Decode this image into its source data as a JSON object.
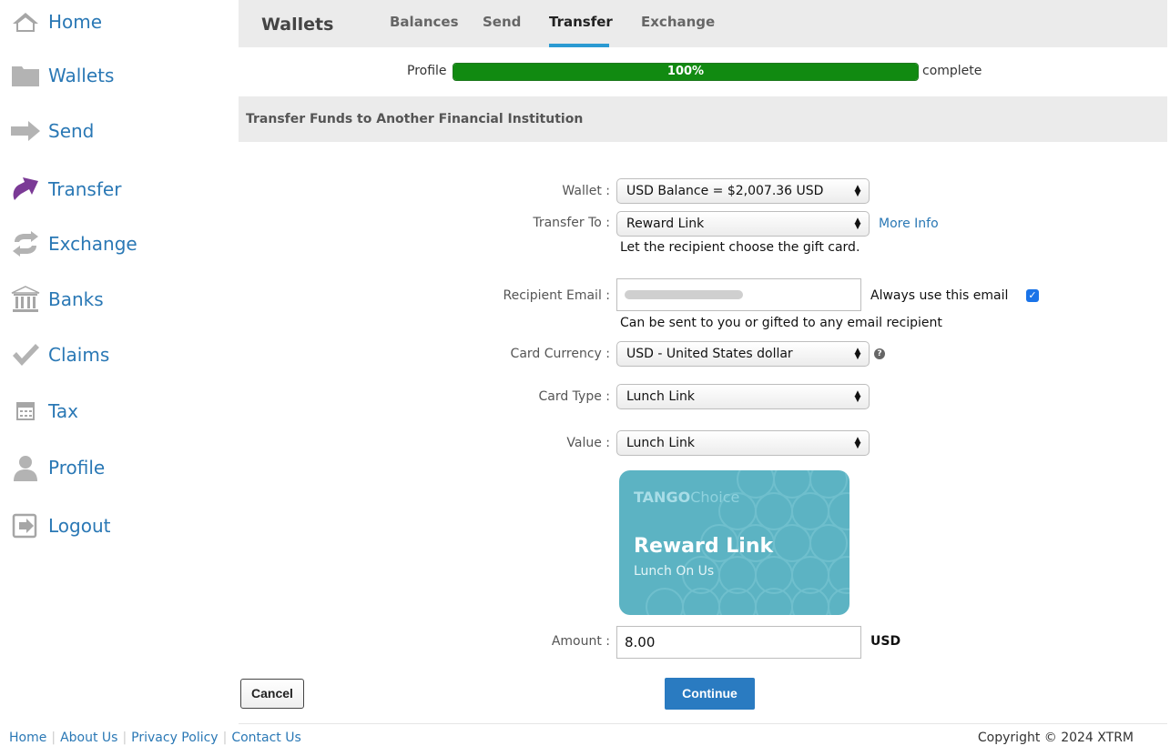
{
  "sidebar": {
    "items": [
      {
        "label": "Home",
        "icon": "home-icon"
      },
      {
        "label": "Wallets",
        "icon": "folder-icon"
      },
      {
        "label": "Send",
        "icon": "arrow-right-icon"
      },
      {
        "label": "Transfer",
        "icon": "transfer-icon"
      },
      {
        "label": "Exchange",
        "icon": "exchange-icon"
      },
      {
        "label": "Banks",
        "icon": "bank-icon"
      },
      {
        "label": "Claims",
        "icon": "checkmark-icon"
      },
      {
        "label": "Tax",
        "icon": "calculator-icon"
      },
      {
        "label": "Profile",
        "icon": "user-icon"
      },
      {
        "label": "Logout",
        "icon": "logout-icon"
      }
    ],
    "active": "Transfer",
    "active_color": "#7b3a96"
  },
  "header": {
    "title": "Wallets",
    "tabs": [
      {
        "label": "Balances"
      },
      {
        "label": "Send"
      },
      {
        "label": "Transfer"
      },
      {
        "label": "Exchange"
      }
    ],
    "active_tab": "Transfer"
  },
  "profile_progress": {
    "prefix": "Profile",
    "value_text": "100%",
    "suffix": "complete",
    "fraction": 1.0,
    "color": "#118a11"
  },
  "section": {
    "title": "Transfer Funds to Another Financial Institution"
  },
  "form": {
    "wallet": {
      "label": "Wallet :",
      "value": "USD Balance = $2,007.36 USD"
    },
    "transfer_to": {
      "label": "Transfer To :",
      "value": "Reward Link",
      "more_info": "More Info",
      "hint": "Let the recipient choose the gift card."
    },
    "recipient_email": {
      "label": "Recipient Email :",
      "value": "[redacted]",
      "always_use": "Always use this email",
      "always_use_checked": true,
      "hint": "Can be sent to you or gifted to any email recipient"
    },
    "card_currency": {
      "label": "Card Currency :",
      "value": "USD - United States dollar"
    },
    "card_type": {
      "label": "Card Type :",
      "value": "Lunch Link"
    },
    "value": {
      "label": "Value :",
      "value": "Lunch Link"
    },
    "amount": {
      "label": "Amount :",
      "value": "8.00",
      "currency": "USD"
    }
  },
  "card": {
    "brand_bold": "TANGO",
    "brand_rest": "Choice",
    "name": "Reward Link",
    "subtitle": "Lunch On Us",
    "color": "#5cb3c3"
  },
  "buttons": {
    "cancel": "Cancel",
    "continue": "Continue"
  },
  "footer": {
    "links": [
      "Home",
      "About Us",
      "Privacy Policy",
      "Contact Us"
    ],
    "copyright": "Copyright © 2024 XTRM"
  }
}
